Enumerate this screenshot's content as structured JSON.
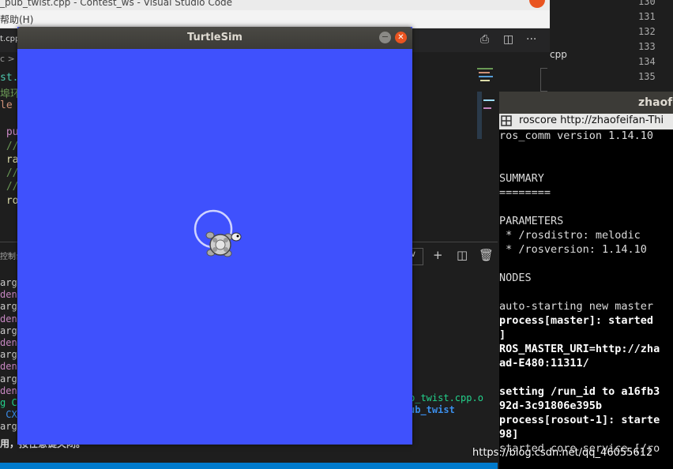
{
  "vscode": {
    "window_title": "_pub_twist.cpp - Contest_ws - Visual Studio Code",
    "menu_help": "帮助(H)",
    "tab_label": "t.cpp",
    "breadcrumb": "c > s",
    "code_lines": [
      {
        "text": "st.",
        "color": "#4ec9b0"
      },
      {
        "text": "埠环发",
        "color": "#6a9955"
      },
      {
        "text": "le",
        "color": "#ce9178"
      },
      {
        "text": "",
        "color": "#d4d4d4"
      },
      {
        "text": " pul",
        "color": "#c586c0"
      },
      {
        "text": " //",
        "color": "#6a9955"
      },
      {
        "text": " ra",
        "color": "#dcdcaa"
      },
      {
        "text": " //",
        "color": "#6a9955"
      },
      {
        "text": " //",
        "color": "#6a9955"
      },
      {
        "text": " ro",
        "color": "#dcdcaa"
      }
    ],
    "panel_label": "控制台",
    "terminal_select": "∨",
    "terminal_lines": [
      {
        "text": "arg",
        "color": "#cccccc"
      },
      {
        "text": "den",
        "color": "#c586c0"
      },
      {
        "text": "arg",
        "color": "#cccccc"
      },
      {
        "text": "den",
        "color": "#c586c0"
      },
      {
        "text": "arg",
        "color": "#cccccc"
      },
      {
        "text": "den",
        "color": "#c586c0"
      },
      {
        "text": "arg",
        "color": "#cccccc"
      },
      {
        "text": "den",
        "color": "#c586c0"
      },
      {
        "text": "arg",
        "color": "#cccccc"
      },
      {
        "text": "den",
        "color": "#c586c0"
      },
      {
        "text": "g C",
        "color": "#23d18b"
      },
      {
        "text": " CX",
        "color": "#3b8eea"
      },
      {
        "text": "arg",
        "color": "#cccccc"
      }
    ],
    "right_output_1": "b_twist.cpp.o",
    "right_output_2": "ub_twist",
    "bottom_message": "用，按任意键关闭。",
    "line_numbers": [
      "130",
      "131",
      "132",
      "133",
      "134",
      "135"
    ],
    "explorer_file": "cpp"
  },
  "terminal": {
    "title": "zhaofe",
    "tab_label": "roscore http://zhaofeifan-Thi",
    "lines": [
      {
        "text": "ros_comm version 1.14.10",
        "bold": false
      },
      {
        "text": "",
        "bold": false
      },
      {
        "text": "",
        "bold": false
      },
      {
        "text": "SUMMARY",
        "bold": false
      },
      {
        "text": "========",
        "bold": false
      },
      {
        "text": "",
        "bold": false
      },
      {
        "text": "PARAMETERS",
        "bold": false
      },
      {
        "text": " * /rosdistro: melodic",
        "bold": false
      },
      {
        "text": " * /rosversion: 1.14.10",
        "bold": false
      },
      {
        "text": "",
        "bold": false
      },
      {
        "text": "NODES",
        "bold": false
      },
      {
        "text": "",
        "bold": false
      },
      {
        "text": "auto-starting new master",
        "bold": false
      },
      {
        "text": "process[master]: started",
        "bold": true
      },
      {
        "text": "]",
        "bold": true
      },
      {
        "text": "ROS_MASTER_URI=http://zha",
        "bold": true
      },
      {
        "text": "ad-E480:11311/",
        "bold": true
      },
      {
        "text": "",
        "bold": false
      },
      {
        "text": "setting /run_id to a16fb3",
        "bold": true
      },
      {
        "text": "92d-3c91806e395b",
        "bold": true
      },
      {
        "text": "process[rosout-1]: starte",
        "bold": true
      },
      {
        "text": "98]",
        "bold": true
      },
      {
        "text": "started core service [/ro",
        "bold": false
      }
    ]
  },
  "turtlesim": {
    "title": "TurtleSim",
    "minimize_glyph": "−",
    "close_glyph": "✕",
    "background_color": "#3f51fd"
  },
  "watermark": "https://blog.csdn.net/qq_46055612"
}
